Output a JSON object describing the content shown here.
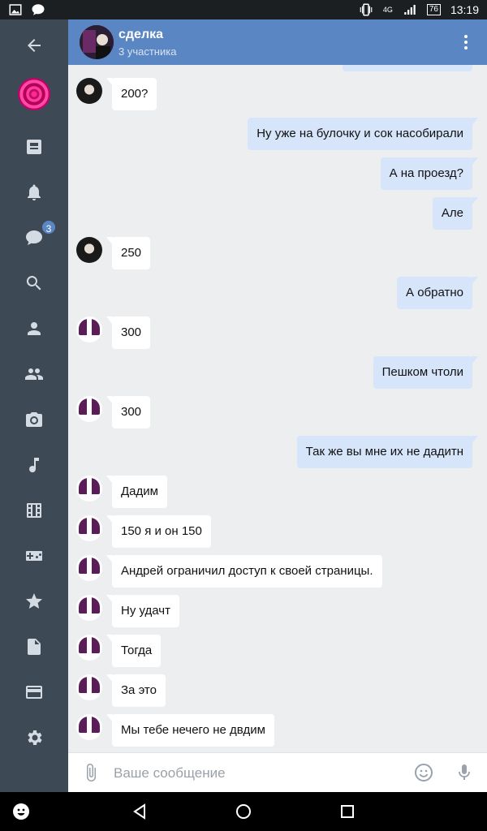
{
  "status_bar": {
    "network": "4G",
    "battery": "76",
    "time": "13:19"
  },
  "sidebar": {
    "items": [
      {
        "icon": "back-arrow-icon"
      },
      {
        "icon": "profile-avatar"
      },
      {
        "icon": "news-icon"
      },
      {
        "icon": "bell-icon"
      },
      {
        "icon": "messages-icon",
        "badge": "3"
      },
      {
        "icon": "search-icon"
      },
      {
        "icon": "friends-icon"
      },
      {
        "icon": "groups-icon"
      },
      {
        "icon": "camera-icon"
      },
      {
        "icon": "music-icon"
      },
      {
        "icon": "video-icon"
      },
      {
        "icon": "games-icon"
      },
      {
        "icon": "star-icon"
      },
      {
        "icon": "document-icon"
      },
      {
        "icon": "payment-icon"
      },
      {
        "icon": "gear-icon"
      }
    ]
  },
  "header": {
    "title": "сделка",
    "subtitle": "3 участника"
  },
  "messages": [
    {
      "dir": "in",
      "avatar": "photo",
      "text": "200?"
    },
    {
      "dir": "out",
      "text": "Ну уже на булочку и сок насобирали"
    },
    {
      "dir": "out",
      "text": "А на проезд?"
    },
    {
      "dir": "out",
      "text": "Але"
    },
    {
      "dir": "in",
      "avatar": "photo",
      "text": "250"
    },
    {
      "dir": "out",
      "text": "А обратно"
    },
    {
      "dir": "in",
      "avatar": "logo",
      "text": "300"
    },
    {
      "dir": "out",
      "text": "Пешком чтоли"
    },
    {
      "dir": "in",
      "avatar": "logo",
      "text": "300"
    },
    {
      "dir": "out",
      "text": "Так же вы мне их не дадитн"
    },
    {
      "dir": "in",
      "avatar": "logo",
      "text": "Дадим"
    },
    {
      "dir": "in",
      "avatar": "logo",
      "text": "150 я и он 150"
    },
    {
      "dir": "in",
      "avatar": "logo",
      "text": "Андрей ограничил доступ к своей страницы."
    },
    {
      "dir": "in",
      "avatar": "logo",
      "text": "Ну удачт"
    },
    {
      "dir": "in",
      "avatar": "logo",
      "text": "Тогда"
    },
    {
      "dir": "in",
      "avatar": "logo",
      "text": "За это"
    },
    {
      "dir": "in",
      "avatar": "logo",
      "text": "Мы тебе нечего не двдим"
    }
  ],
  "composer": {
    "placeholder": "Ваше сообщение",
    "value": ""
  },
  "colors": {
    "header": "#5b86c4",
    "sidebar": "#3d4955",
    "outgoing_bubble": "#d6e5fa",
    "incoming_bubble": "#ffffff"
  }
}
